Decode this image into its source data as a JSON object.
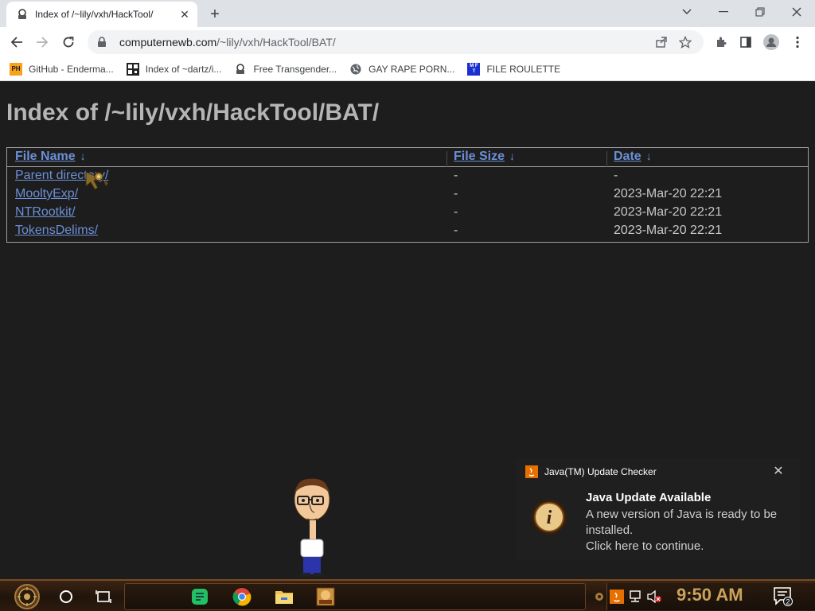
{
  "browser": {
    "tab_title": "Index of /~lily/vxh/HackTool/",
    "url_host": "computernewb.com",
    "url_path": "/~lily/vxh/HackTool/BAT/",
    "bookmarks": [
      {
        "label": "GitHub - Enderma...",
        "icon": "ph-icon"
      },
      {
        "label": "Index of ~dartz/i...",
        "icon": "qr-icon"
      },
      {
        "label": "Free Transgender...",
        "icon": "cyborg-icon"
      },
      {
        "label": "GAY RAPE PORN...",
        "icon": "globe-icon"
      },
      {
        "label": "FILE ROULETTE",
        "icon": "mft-icon"
      }
    ]
  },
  "page": {
    "title": "Index of /~lily/vxh/HackTool/BAT/",
    "columns": {
      "name": "File Name",
      "size": "File Size",
      "date": "Date",
      "sort_arrow": "↓"
    },
    "rows": [
      {
        "name": "Parent directory/",
        "size": "-",
        "date": "-"
      },
      {
        "name": "MooltyExp/",
        "size": "-",
        "date": "2023-Mar-20 22:21"
      },
      {
        "name": "NTRootkit/",
        "size": "-",
        "date": "2023-Mar-20 22:21"
      },
      {
        "name": "TokensDelims/",
        "size": "-",
        "date": "2023-Mar-20 22:21"
      }
    ]
  },
  "notification": {
    "app": "Java(TM) Update Checker",
    "title": "Java Update Available",
    "body_line1": "A new version of Java is ready to be installed.",
    "body_line2": "Click here to continue.",
    "info_glyph": "i"
  },
  "taskbar": {
    "clock": "9:50 AM",
    "notification_count": "2"
  },
  "colors": {
    "link": "#6c8fd6",
    "page_bg": "#1d1d1d",
    "clock": "#c9a35a"
  }
}
